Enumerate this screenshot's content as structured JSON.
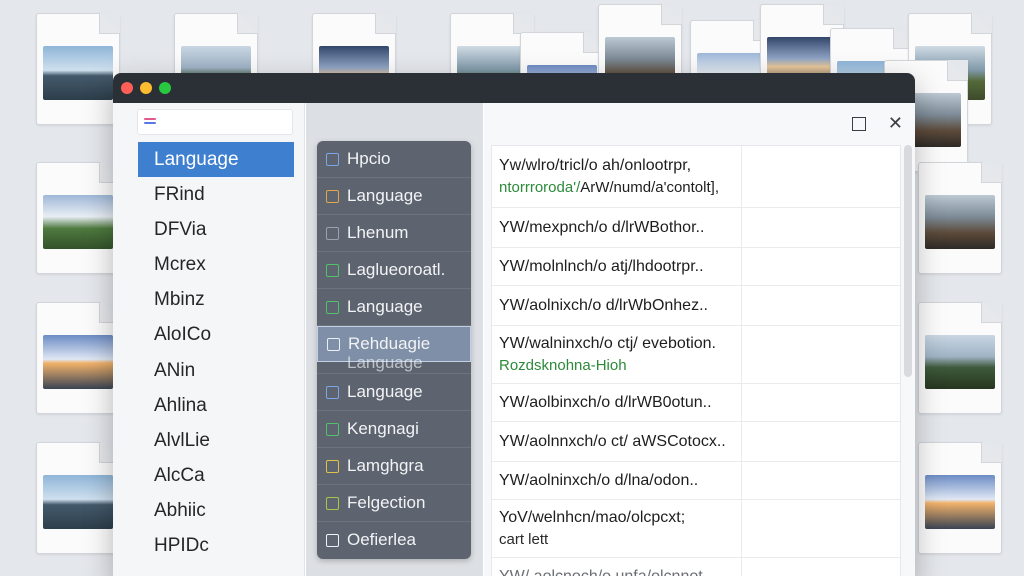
{
  "sidebar": {
    "items": [
      {
        "label": "Language",
        "selected": true
      },
      {
        "label": "FRind",
        "selected": false
      },
      {
        "label": "DFVia",
        "selected": false
      },
      {
        "label": "Mcrex",
        "selected": false
      },
      {
        "label": "Mbinz",
        "selected": false
      },
      {
        "label": "AloICo",
        "selected": false
      },
      {
        "label": "ANin",
        "selected": false
      },
      {
        "label": "Ahlina",
        "selected": false
      },
      {
        "label": "AlvlLie",
        "selected": false
      },
      {
        "label": "AlcCa",
        "selected": false
      },
      {
        "label": "Abhiic",
        "selected": false
      },
      {
        "label": "HPIDc",
        "selected": false
      }
    ]
  },
  "list": {
    "items": [
      {
        "label": "Hpcio",
        "checkbox_color": "#7aa7e6"
      },
      {
        "label": "Language",
        "checkbox_color": "#e0a84a"
      },
      {
        "label": "Lhenum",
        "checkbox_color": "#9aa3ad"
      },
      {
        "label": "Laglueoroatl.",
        "checkbox_color": "#4fc26a"
      },
      {
        "label": "Language",
        "checkbox_color": "#4fc26a"
      },
      {
        "label": "Rehduagie",
        "checkbox_color": "#eaf0f8",
        "selected": true,
        "ghost": "Language"
      },
      {
        "label": "Language",
        "checkbox_color": "#7aa7e6"
      },
      {
        "label": "Kengnagi",
        "checkbox_color": "#4fc26a"
      },
      {
        "label": "Lamghgra",
        "checkbox_color": "#e0c24a"
      },
      {
        "label": "Felgection",
        "checkbox_color": "#a6c84a"
      },
      {
        "label": "Oefierlea",
        "checkbox_color": "#eef1f5"
      }
    ]
  },
  "table": {
    "rows": [
      {
        "text": "Yw/wlro/tricl/o ah/onlootrpr,",
        "sub": "ntorrroroda'/ArW/numd/a'contolt],",
        "sub_style": "mixed"
      },
      {
        "text": "YW/mexpnch/o d/lrWBothor..",
        "sub": ""
      },
      {
        "text": "YW/molnlnch/o atj/lhdootrpr..",
        "sub": ""
      },
      {
        "text": "YW/aolnixch/o d/lrWbOnhez..",
        "sub": ""
      },
      {
        "text": "YW/walninxch/o ctj/ evebotion.",
        "sub": "Rozdsknohna-Hioh",
        "sub_style": "green"
      },
      {
        "text": "YW/aolbinxch/o d/lrWB0otun..",
        "sub": ""
      },
      {
        "text": "YW/aolnnxch/o ct/ aWSCotocx..",
        "sub": ""
      },
      {
        "text": "YW/aolninxch/o d/lna/odon..",
        "sub": ""
      },
      {
        "text": "YoV/welnhcn/mao/olcpcxt;",
        "sub": "cart lett"
      },
      {
        "text": "YW/ aolcnoch/o unfa/olcnnot",
        "sub": ""
      }
    ]
  },
  "window_controls": {
    "maximize_icon": "□",
    "close_icon": "✕"
  },
  "colors": {
    "accent": "#3f7fd0",
    "titlebar": "#2b2f36",
    "list_panel": "#5d6470"
  }
}
